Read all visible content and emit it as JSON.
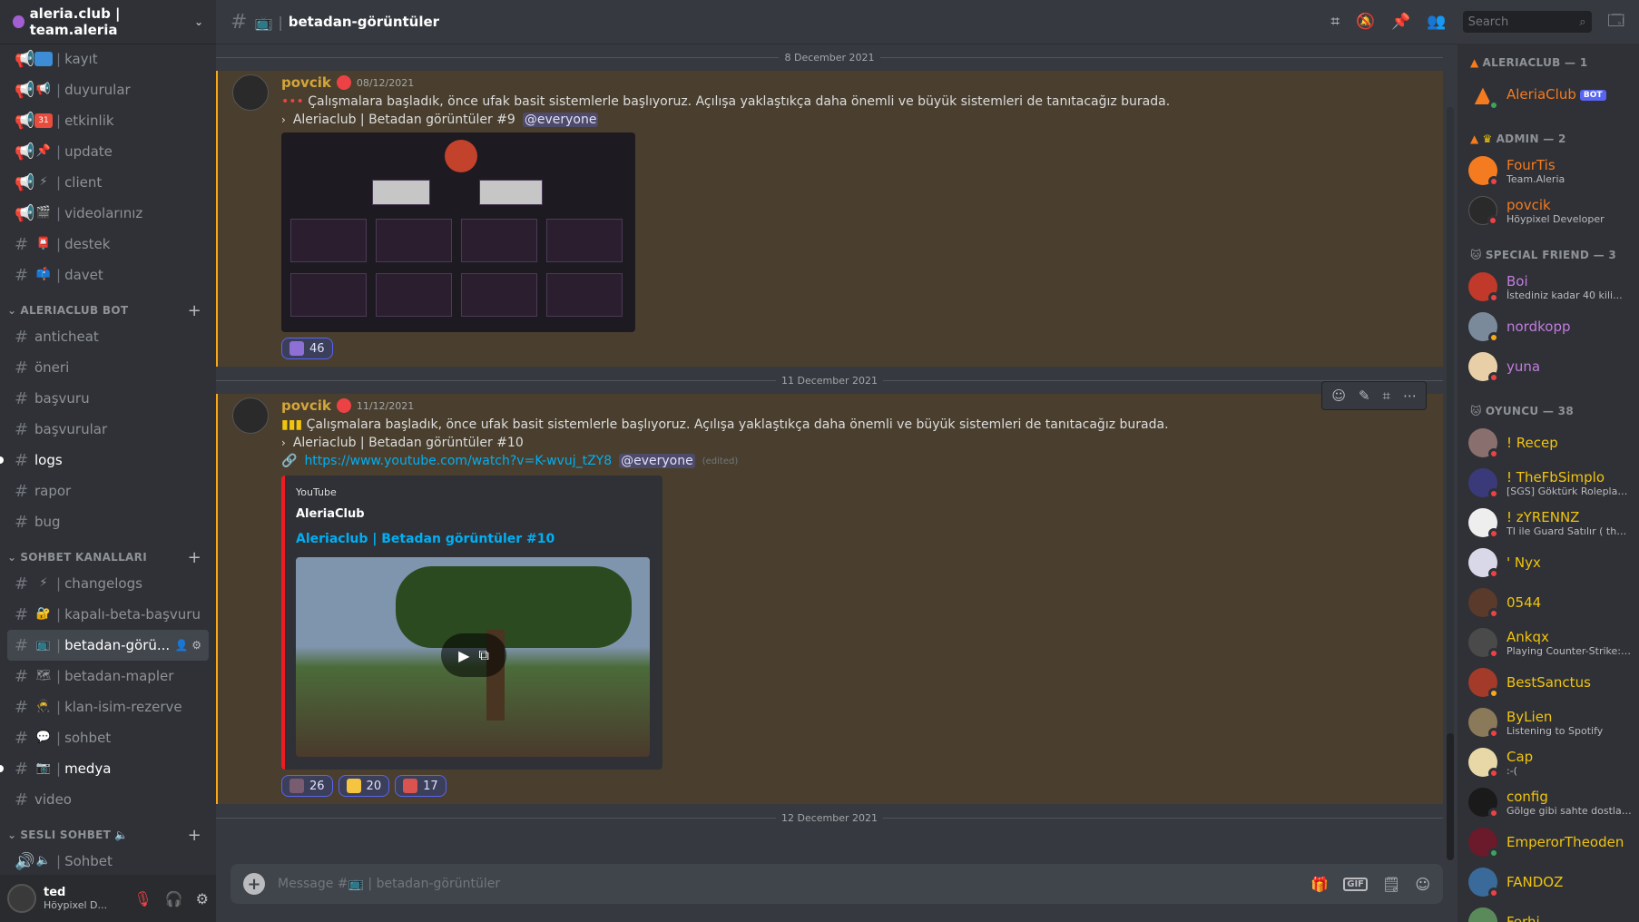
{
  "server": {
    "name": "aleria.club | team.aleria"
  },
  "sidebar": {
    "channels_top": [
      {
        "name": "kayıt",
        "type": "announce"
      },
      {
        "name": "duyurular",
        "type": "announce"
      },
      {
        "name": "etkinlik",
        "type": "announce"
      },
      {
        "name": "update",
        "type": "announce"
      },
      {
        "name": "client",
        "type": "announce"
      },
      {
        "name": "videolarınız",
        "type": "announce"
      },
      {
        "name": "destek",
        "type": "text"
      },
      {
        "name": "davet",
        "type": "text"
      }
    ],
    "cat_bot": "ALERIACLUB BOT",
    "channels_bot": [
      {
        "name": "anticheat"
      },
      {
        "name": "öneri"
      },
      {
        "name": "başvuru"
      },
      {
        "name": "başvurular"
      },
      {
        "name": "logs"
      },
      {
        "name": "rapor"
      },
      {
        "name": "bug"
      }
    ],
    "cat_chat": "SOHBET KANALLARI",
    "channels_chat": [
      {
        "name": "changelogs"
      },
      {
        "name": "kapalı-beta-başvuru"
      },
      {
        "name": "betadan-görü..."
      },
      {
        "name": "betadan-mapler"
      },
      {
        "name": "klan-isim-rezerve"
      },
      {
        "name": "sohbet"
      },
      {
        "name": "medya"
      },
      {
        "name": "video"
      }
    ],
    "cat_voice": "SESLI SOHBET",
    "channels_voice": [
      {
        "name": "Sohbet"
      }
    ]
  },
  "user": {
    "name": "ted",
    "status": "Höypixel D..."
  },
  "topbar": {
    "channel": "betadan-görüntüler",
    "search_placeholder": "Search"
  },
  "messages": [
    {
      "date": "8 December 2021",
      "author": "povcik",
      "time": "08/12/2021",
      "text": "Çalışmalara başladık, önce ufak basit sistemlerle başlıyoruz. Açılışa yaklaştıkça daha önemli ve büyük sistemleri de tanıtacağız burada.",
      "quote": "Aleriaclub |  Betadan görüntüler #9",
      "mention": "@everyone",
      "reactions": [
        {
          "count": "46",
          "color": "#8e6fd6"
        }
      ]
    },
    {
      "date": "11 December 2021",
      "author": "povcik",
      "time": "11/12/2021",
      "text": "Çalışmalara başladık, önce ufak basit sistemlerle başlıyoruz. Açılışa yaklaştıkça daha önemli ve büyük sistemleri de tanıtacağız burada.",
      "quote": "Aleriaclub |  Betadan görüntüler #10",
      "link": "https://www.youtube.com/watch?v=K-wvuj_tZY8",
      "mention": "@everyone",
      "edited": "(edited)",
      "embed": {
        "provider": "YouTube",
        "author": "AleriaClub",
        "title": "Aleriaclub | Betadan görüntüler #10"
      },
      "reactions": [
        {
          "count": "26",
          "color": "#7a5c70"
        },
        {
          "count": "20",
          "color": "#f5c542"
        },
        {
          "count": "17",
          "color": "#d9534f"
        }
      ]
    }
  ],
  "next_date": "12 December 2021",
  "composer": {
    "placeholder": "Message #📺 | betadan-görüntüler"
  },
  "members": {
    "cat_aleria": "ALERIACLUB — 1",
    "aleria": [
      {
        "name": "AleriaClub",
        "color": "#f47b20",
        "bot": "BOT",
        "sub": ""
      }
    ],
    "cat_admin": "ADMIN — 2",
    "admin": [
      {
        "name": "FourTis",
        "color": "#f47b20",
        "sub": "Team.Aleria"
      },
      {
        "name": "povcik",
        "color": "#f47b20",
        "sub": "Höypixel Developer"
      }
    ],
    "cat_special": "SPECIAL FRIEND — 3",
    "special": [
      {
        "name": "Boi",
        "color": "#c27cde",
        "sub": "İstediniz kadar 40 kili..."
      },
      {
        "name": "nordkopp",
        "color": "#c27cde",
        "sub": ""
      },
      {
        "name": "yuna",
        "color": "#c27cde",
        "sub": ""
      }
    ],
    "cat_player": "OYUNCU — 38",
    "player": [
      {
        "name": "! Recep",
        "color": "#f1c40f",
        "sub": ""
      },
      {
        "name": "! TheFbSimplo",
        "color": "#f1c40f",
        "sub": "[SGS] Göktürk Roleplay :htt..."
      },
      {
        "name": "! zYRENNZ",
        "color": "#f1c40f",
        "sub": "TI ile Guard Satılır ( the kin..."
      },
      {
        "name": "' Nyx",
        "color": "#f1c40f",
        "sub": ""
      },
      {
        "name": "0544",
        "color": "#f1c40f",
        "sub": ""
      },
      {
        "name": "Ankqx",
        "color": "#f1c40f",
        "sub": "Playing Counter-Strike: Glob..."
      },
      {
        "name": "BestSanctus",
        "color": "#f1c40f",
        "sub": ""
      },
      {
        "name": "ByLien",
        "color": "#f1c40f",
        "sub": "Listening to Spotify"
      },
      {
        "name": "Cap",
        "color": "#f1c40f",
        "sub": ":-("
      },
      {
        "name": "config",
        "color": "#f1c40f",
        "sub": "Gölge gibi sahte dostlar..."
      },
      {
        "name": "EmperorTheoden",
        "color": "#f1c40f",
        "sub": ""
      },
      {
        "name": "FANDOZ",
        "color": "#f1c40f",
        "sub": ""
      },
      {
        "name": "Ferhi",
        "color": "#f1c40f",
        "sub": ""
      }
    ]
  },
  "colors": {
    "accent": "#5865f2",
    "highlight": "#faa81a",
    "link": "#00aff4",
    "youtube": "#ed1c24"
  }
}
